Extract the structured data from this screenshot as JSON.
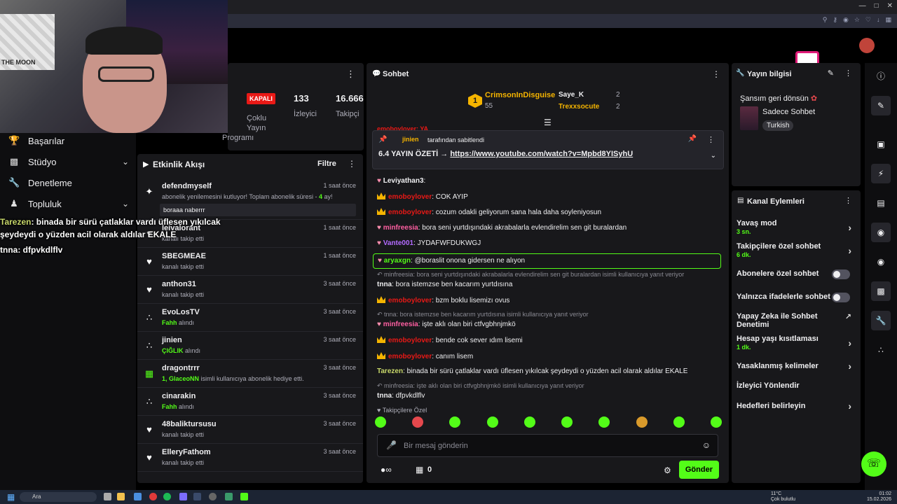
{
  "colors": {
    "accent": "#53fc18",
    "offline": "#e91916",
    "gold": "#f5b400",
    "bg": "#18181b"
  },
  "stats": {
    "status": "KAPALI",
    "viewers": "133",
    "viewers_label": "İzleyici",
    "followers": "16.666",
    "followers_label": "Takipçi",
    "multi_label": "Çoklu Yayın",
    "program_label": "Programı"
  },
  "nav": [
    {
      "label": "Başarılar",
      "icon": "trophy-icon",
      "has_chevron": false
    },
    {
      "label": "Stüdyo",
      "icon": "studio-icon",
      "has_chevron": true
    },
    {
      "label": "Denetleme",
      "icon": "wrench-icon",
      "has_chevron": false
    },
    {
      "label": "Topluluk",
      "icon": "community-icon",
      "has_chevron": true
    }
  ],
  "overlay": [
    {
      "user": "Tarezen",
      "text": ": binada bir sürü çatlaklar vardı üflesen yıkılcak şeydeydi o yüzden acil olarak aldılar EKALE"
    },
    {
      "user": "tnna",
      "text": ": dfpvkdlflv"
    }
  ],
  "webcam": {
    "poster_caption": "THE MOON"
  },
  "feed": {
    "title": "Etkinlik Akışı",
    "filter": "Filtre",
    "items": [
      {
        "name": "defendmyself",
        "sub": "abonelik yenilemesini kutluyor! Toplam abonelik süresi - ",
        "sub_hl": "4",
        "sub_after": " ay!",
        "time": "1 saat önce",
        "icon": "sparkle-icon",
        "reply": "boraaa naberrr"
      },
      {
        "name": "leivalorant",
        "sub": "kanalı takip etti",
        "time": "1 saat önce",
        "icon": "heart-icon"
      },
      {
        "name": "SBEGMEAE",
        "sub": "kanalı takip etti",
        "time": "1 saat önce",
        "icon": "heart-icon"
      },
      {
        "name": "anthon31",
        "sub": "kanalı takip etti",
        "time": "3 saat önce",
        "icon": "heart-icon"
      },
      {
        "name": "EvoLosTV",
        "sub_hl": "Fahh",
        "sub": " alındı",
        "time": "3 saat önce",
        "icon": "dots-icon"
      },
      {
        "name": "jinien",
        "sub_hl": "ÇIĞLIK",
        "sub": " alındı",
        "time": "3 saat önce",
        "icon": "dots-icon"
      },
      {
        "name": "dragontrrr",
        "sub_hl": "1, GlaceoNN",
        "sub": " isimli kullanıcıya abonelik hediye etti.",
        "time": "3 saat önce",
        "icon": "gift-icon"
      },
      {
        "name": "cinarakin",
        "sub_hl": "Fahh",
        "sub": " alındı",
        "time": "3 saat önce",
        "icon": "dots-icon"
      },
      {
        "name": "48baliktursusu",
        "sub": "kanalı takip etti",
        "time": "3 saat önce",
        "icon": "heart-icon"
      },
      {
        "name": "ElleryFathom",
        "sub": "kanalı takip etti",
        "time": "3 saat önce",
        "icon": "heart-icon"
      }
    ]
  },
  "chat": {
    "title": "Sohbet",
    "leaders": [
      {
        "rank": "1",
        "name": "CrimsonInDisguise",
        "count": "55"
      },
      {
        "name": "Saye_K",
        "count": "2"
      },
      {
        "name": "Trexxsocute",
        "count": "2"
      }
    ],
    "pinned": {
      "by": "jinien",
      "by_suffix": "tarafından sabitlendi",
      "text": "6.4 YAYIN ÖZETİ → ",
      "link": "https://www.youtube.com/watch?v=Mpbd8YISyhU"
    },
    "top_partial": "emoboylover: YA",
    "messages": [
      {
        "user": "Leviyathan3",
        "color": "#efeff1",
        "text": ":",
        "badge": "pig"
      },
      {
        "user": "emoboylover",
        "color": "#e91916",
        "text": ": COK AYIP",
        "badge": "crown"
      },
      {
        "user": "emoboylover",
        "color": "#e91916",
        "text": ": cozum odakli geliyorum sana hala daha soyleniyosun",
        "badge": "crown"
      },
      {
        "user": "minfreesia",
        "color": "#ff5fa2",
        "text": ": bora seni yurtdışındaki akrabalarla evlendirelim sen git buralardan",
        "badge": "pig"
      },
      {
        "user": "Vante001",
        "color": "#b36bff",
        "text": ": JYDAFWFDUKWGJ",
        "badge": "pig"
      },
      {
        "user": "aryaxgn",
        "color": "#53fc18",
        "text": ": @boraslit onona gidersen ne alıyon",
        "badge": "pig",
        "highlight": true
      },
      {
        "reply": "minfreesia: bora seni yurtdışındaki akrabalarla evlendirelim sen git buralardan isimli kullanıcıya yanıt veriyor"
      },
      {
        "user": "tnna",
        "color": "#efeff1",
        "text": ": bora istemzse ben kacarım yurtdısına"
      },
      {
        "user": "emoboylover",
        "color": "#e91916",
        "text": ": bzm boklu lisemizı ovus",
        "badge": "crown"
      },
      {
        "reply": "tnna: bora istemzse ben kacarım yurtdısına isimli kullanıcıya yanıt veriyor"
      },
      {
        "user": "minfreesia",
        "color": "#ff5fa2",
        "text": ": işte aklı olan biri ctfvgbhnjmkö",
        "badge": "pig"
      },
      {
        "user": "emoboylover",
        "color": "#e91916",
        "text": ": bende cok sever ıdım lisemi",
        "badge": "crown"
      },
      {
        "user": "emoboylover",
        "color": "#e91916",
        "text": ": canım lisem",
        "badge": "crown"
      },
      {
        "user": "Tarezen",
        "color": "#c8d86a",
        "text": ": binada bir sürü çatlaklar vardı üflesen yıkılcak şeydeydi o yüzden acil olarak aldılar EKALE"
      },
      {
        "reply": "minfreesia: işte aklı olan biri ctfvgbhnjmkö isimli kullanıcıya yanıt veriyor"
      },
      {
        "user": "tnna",
        "color": "#efeff1",
        "text": ": dfpvkdlflv"
      }
    ],
    "emote_label": "Takipçilere Özel",
    "input_placeholder": "Bir mesaj gönderin",
    "points": "0",
    "send_label": "Gönder"
  },
  "info": {
    "title": "Yayın bilgisi",
    "stream_title": "Şansım geri dönsün",
    "category": "Sadece Sohbet",
    "language": "Turkish"
  },
  "actions": {
    "title": "Kanal Eylemleri",
    "items": [
      {
        "label": "Yavaş mod",
        "sub": "3 sn.",
        "type": "chevron"
      },
      {
        "label": "Takipçilere özel sohbet",
        "sub": "6 dk.",
        "type": "chevron"
      },
      {
        "label": "Abonelere özel sohbet",
        "type": "toggle"
      },
      {
        "label": "Yalnızca ifadelerle sohbet",
        "type": "toggle"
      },
      {
        "label": "Yapay Zeka ile Sohbet Denetimi",
        "type": "external"
      },
      {
        "label": "Hesap yaşı kısıtlaması",
        "sub": "1 dk.",
        "type": "chevron"
      },
      {
        "label": "Yasaklanmış kelimeler",
        "type": "chevron"
      },
      {
        "label": "İzleyici Yönlendir",
        "type": "none"
      },
      {
        "label": "Hedefleri belirleyin",
        "type": "chevron"
      }
    ]
  },
  "taskbar": {
    "search": "Ara",
    "weather_temp": "11°C",
    "weather_text": "Çok bulutlu",
    "time": "01:02",
    "date": "15.02.2026"
  }
}
